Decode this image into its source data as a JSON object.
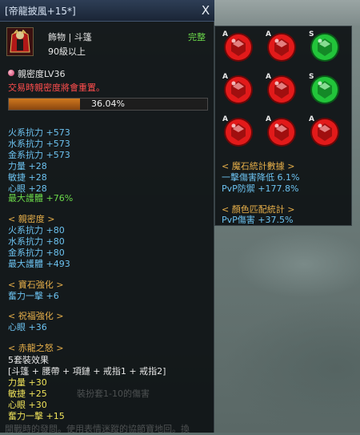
{
  "tooltip": {
    "title": "[帝龍披風+15*]",
    "close_label": "X",
    "item_type": "飾物 | 斗篷",
    "item_status": "完整",
    "level_req": "90級以上",
    "intimacy": "親密度LV36",
    "trade_warning": "交易時親密度將會重置。",
    "progress": {
      "value": 0.3604,
      "label": "36.04%"
    },
    "base_stats": [
      "火系抗力 +573",
      "水系抗力 +573",
      "金系抗力 +573",
      "力量 +28",
      "敏捷 +28",
      "心眼 +28"
    ],
    "base_stat_green": "最大護體 +76%",
    "intimacy_header": "< 親密度 >",
    "intimacy_stats": [
      "火系抗力 +80",
      "水系抗力 +80",
      "金系抗力 +80",
      "最大護體 +493"
    ],
    "gem_header": "< 寶石強化 >",
    "gem_stat": "奮力一擊 +6",
    "bless_header": "< 祝福強化 >",
    "bless_stat": "心眼 +36",
    "set_header": "< 赤龍之怒 >",
    "set_effect_title": "5套裝效果",
    "set_parts": "[斗篷 + 腰帶 + 項鏈 + 戒指1 + 戒指2]",
    "set_stats": [
      "力量 +30",
      "敏捷 +25",
      "心眼 +30",
      "奮力一擊 +15"
    ],
    "faded_text_1": "裝扮套1-10的傷害",
    "faded_text_2": "開戰時的發問。使用表情迷蹤的協節寶地回。換"
  },
  "side_panel": {
    "gems": [
      {
        "tag": "A",
        "color": "red"
      },
      {
        "tag": "A",
        "color": "red"
      },
      {
        "tag": "S",
        "color": "green"
      },
      {
        "tag": "A",
        "color": "red"
      },
      {
        "tag": "A",
        "color": "red"
      },
      {
        "tag": "S",
        "color": "green"
      },
      {
        "tag": "A",
        "color": "red"
      },
      {
        "tag": "A",
        "color": "red"
      },
      {
        "tag": "A",
        "color": "red"
      }
    ],
    "magic_header": "< 魔石統計數據 >",
    "magic_stats": [
      "一擊傷害降低 6.1%",
      "PvP防禦 +177.8%"
    ],
    "color_header": "< 顏色匹配統計 >",
    "color_stats": [
      "PvP傷害 +37.5%"
    ]
  },
  "colors": {
    "red_gem": "#e21a1a",
    "green_gem": "#22c43a",
    "progress_fill": "#d0781e"
  }
}
